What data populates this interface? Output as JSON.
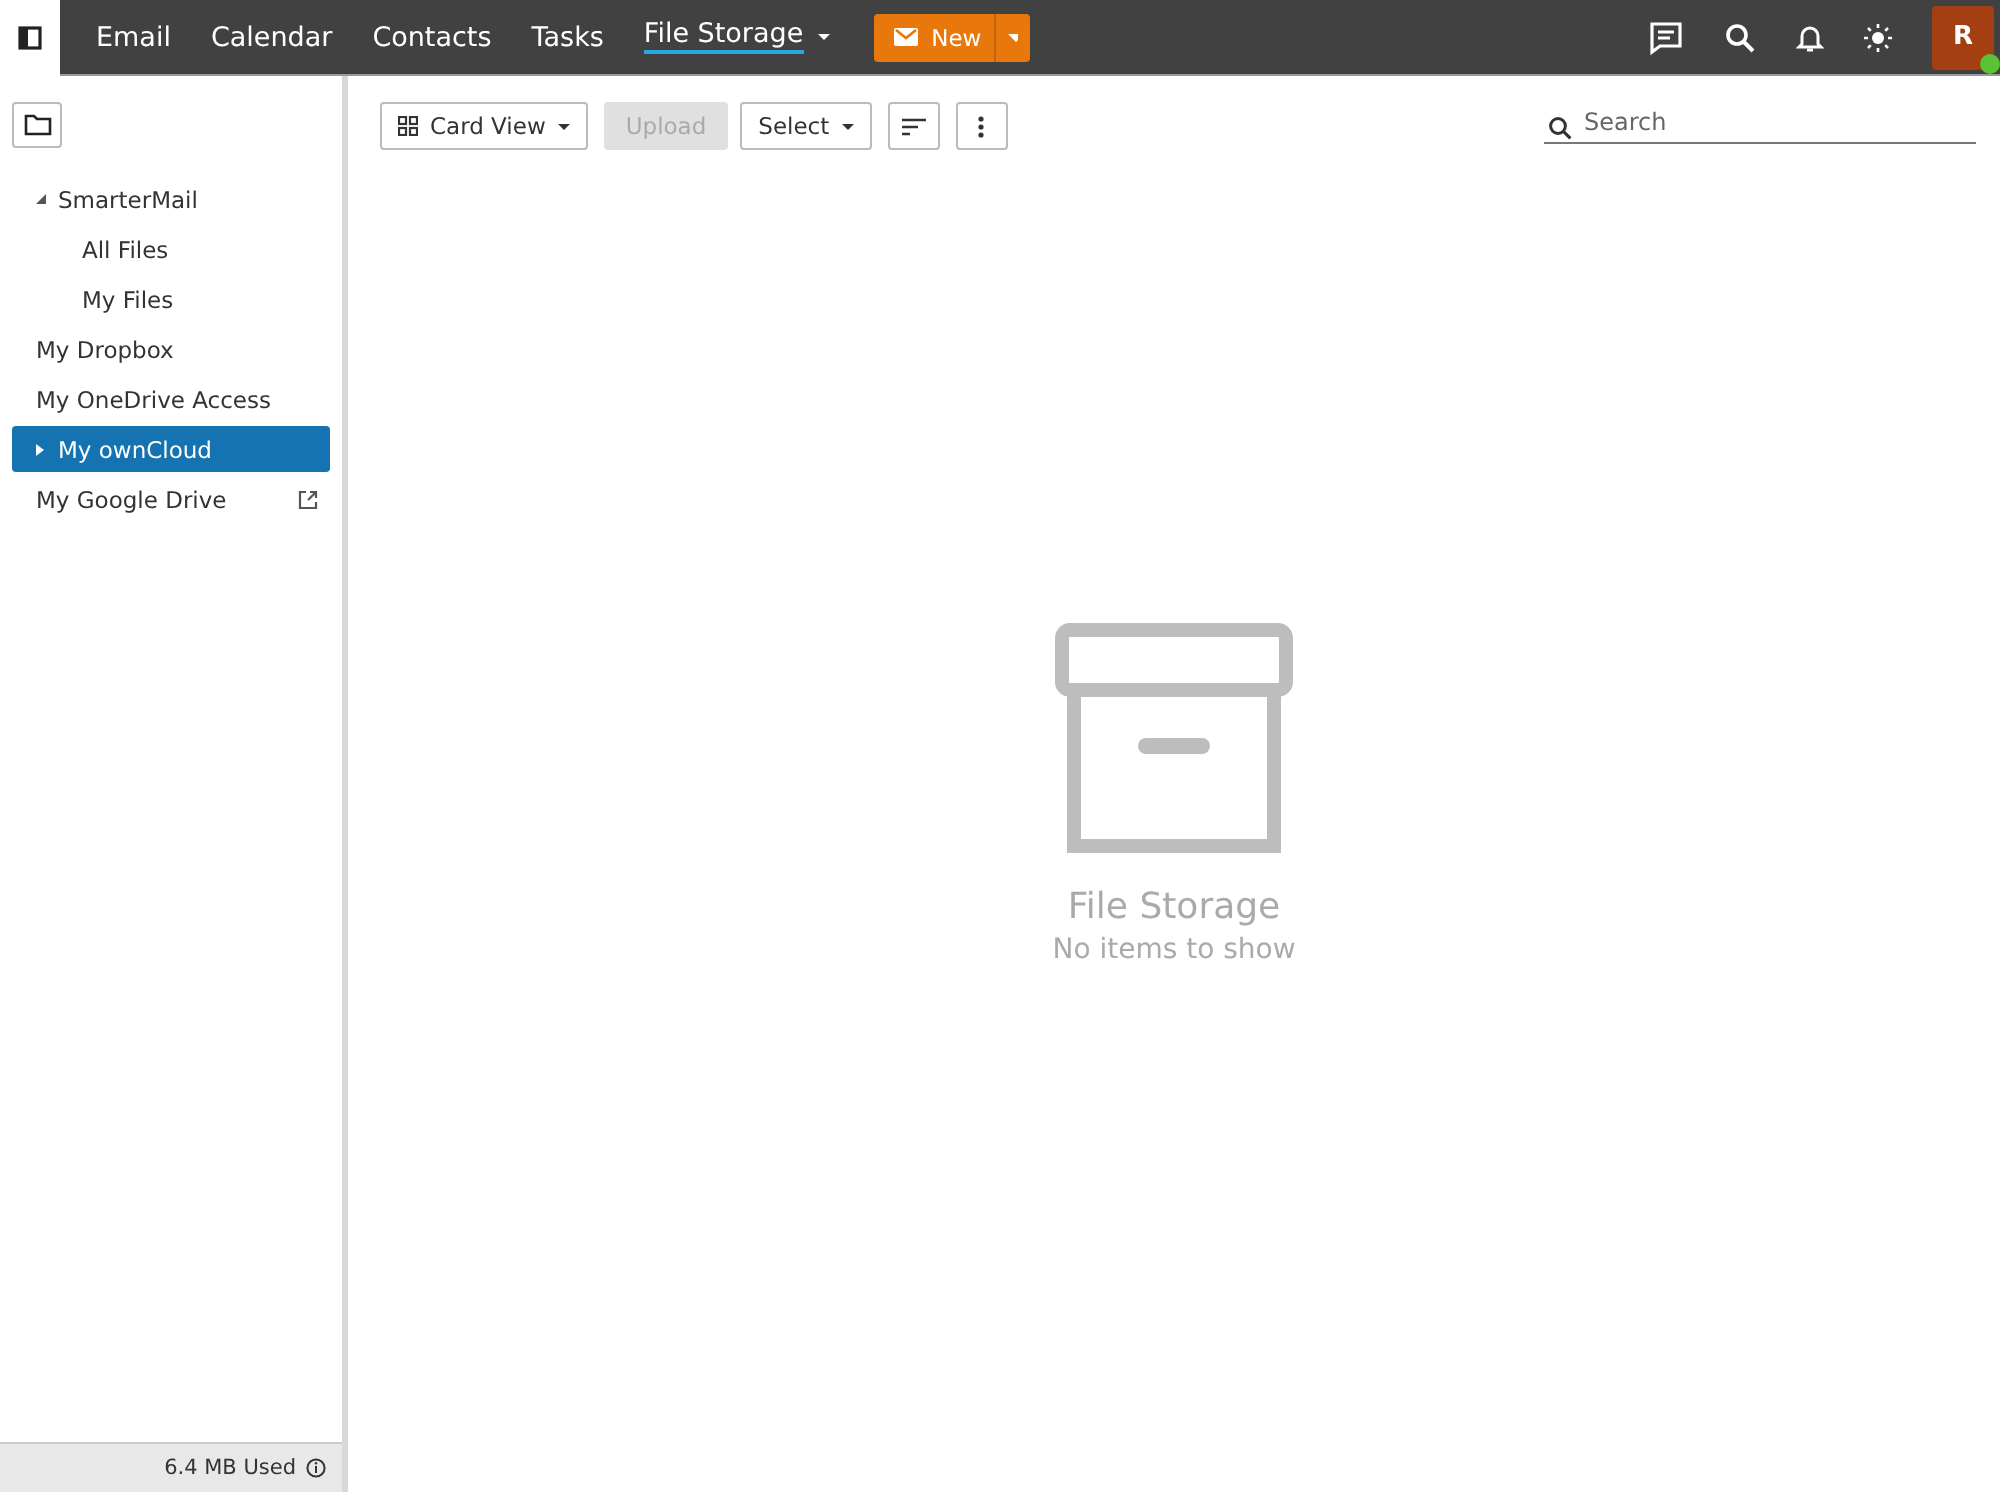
{
  "nav": {
    "tabs": [
      {
        "label": "Email",
        "selected": false
      },
      {
        "label": "Calendar",
        "selected": false
      },
      {
        "label": "Contacts",
        "selected": false
      },
      {
        "label": "Tasks",
        "selected": false
      },
      {
        "label": "File Storage",
        "selected": true,
        "dropdown": true
      }
    ],
    "new_button": "New",
    "avatar": {
      "initial": "R",
      "online": true
    }
  },
  "sidebar": {
    "tree": [
      {
        "label": "SmarterMail",
        "expanded": true,
        "selected": false,
        "children": [
          {
            "label": "All Files",
            "selected": false
          },
          {
            "label": "My Files",
            "selected": false
          }
        ]
      },
      {
        "label": "My Dropbox",
        "selected": false
      },
      {
        "label": "My OneDrive Access",
        "selected": false
      },
      {
        "label": "My ownCloud",
        "expanded": false,
        "selected": true
      },
      {
        "label": "My Google Drive",
        "selected": false,
        "external": true
      }
    ],
    "usage": "6.4 MB Used"
  },
  "toolbar": {
    "view": "Card View",
    "buttons": [
      {
        "label": "Upload",
        "disabled": true
      },
      {
        "label": "Select",
        "disabled": false
      }
    ],
    "search": {
      "placeholder": "Search"
    }
  },
  "empty": {
    "title": "File Storage",
    "message": "No items to show"
  }
}
